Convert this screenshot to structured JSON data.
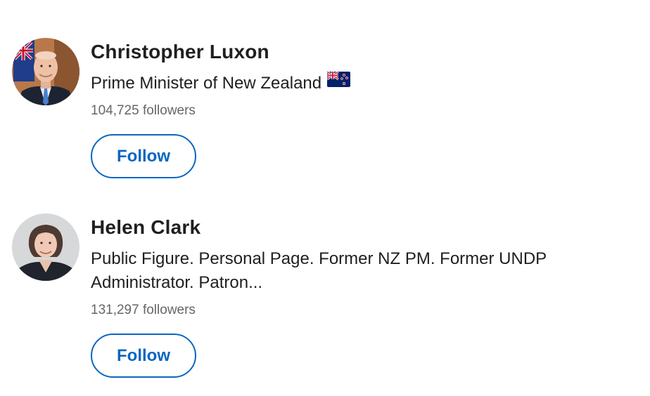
{
  "people": [
    {
      "name": "Christopher Luxon",
      "headline": "Prime Minister of New Zealand",
      "headline_icon": "nz-flag-icon",
      "followers": "104,725 followers",
      "follow_label": "Follow"
    },
    {
      "name": "Helen Clark",
      "headline": "Public Figure. Personal Page. Former NZ PM. Former UNDP Administrator. Patron...",
      "followers": "131,297 followers",
      "follow_label": "Follow"
    }
  ],
  "colors": {
    "accent": "#0a66c2",
    "text_primary": "#1f1f1f",
    "text_secondary": "#666666"
  }
}
